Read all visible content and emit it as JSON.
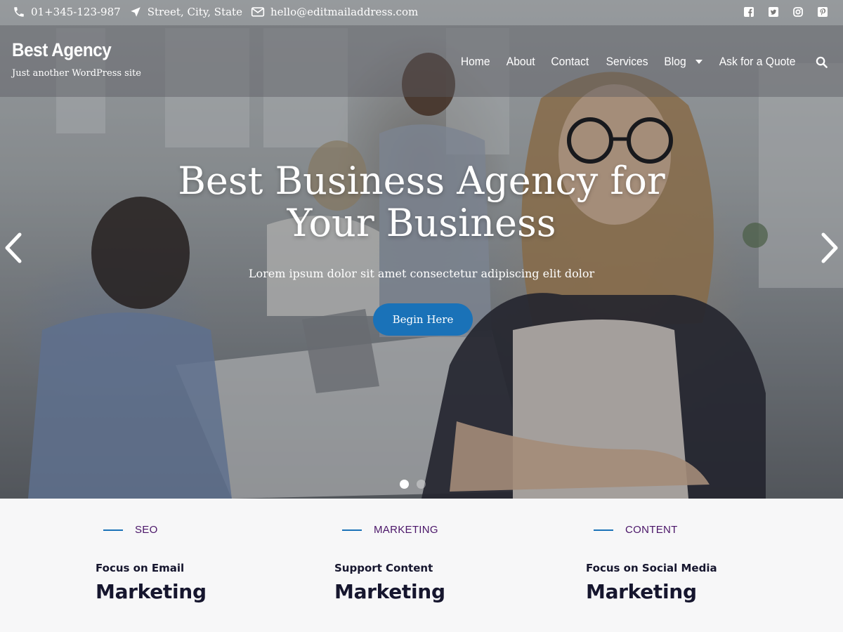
{
  "topbar": {
    "phone": "01+345-123-987",
    "address": "Street, City, State",
    "email": "hello@editmailaddress.com",
    "social": [
      "facebook-icon",
      "twitter-icon",
      "instagram-icon",
      "pinterest-icon"
    ]
  },
  "header": {
    "site_title": "Best Agency",
    "tagline": "Just another WordPress site",
    "nav": [
      "Home",
      "About",
      "Contact",
      "Services",
      "Blog",
      "Ask for a Quote"
    ]
  },
  "hero": {
    "title_line1": "Best Business Agency for",
    "title_line2": "Your Business",
    "subtitle": "Lorem ipsum dolor sit amet consectetur adipiscing elit dolor",
    "cta_label": "Begin Here",
    "slide_count": 2,
    "active_slide": 1
  },
  "features": [
    {
      "category": "SEO",
      "subtitle": "Focus on Email",
      "title": "Marketing"
    },
    {
      "category": "MARKETING",
      "subtitle": "Support Content",
      "title": "Marketing"
    },
    {
      "category": "CONTENT",
      "subtitle": "Focus on Social Media",
      "title": "Marketing"
    }
  ],
  "colors": {
    "accent": "#1a72b8",
    "category_text": "#4a1568",
    "heading_text": "#16162e"
  }
}
